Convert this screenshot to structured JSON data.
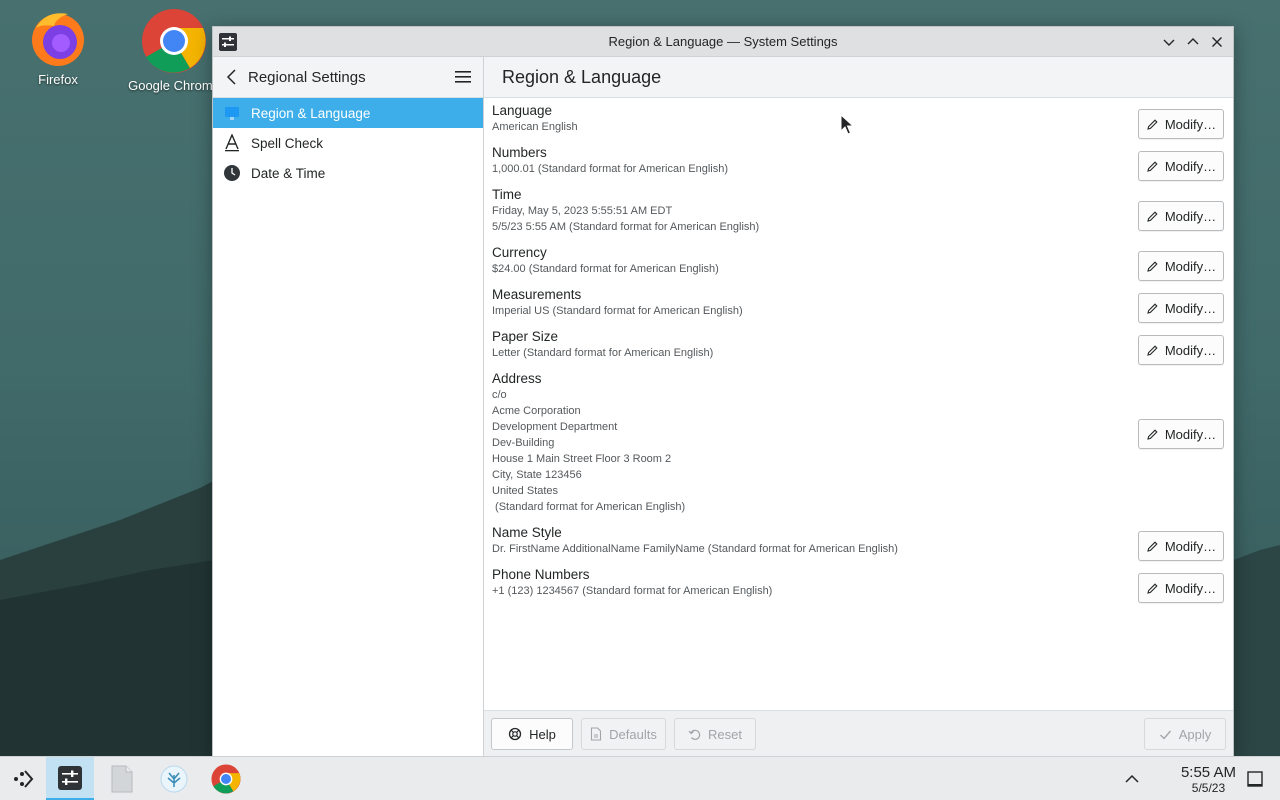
{
  "desktop": {
    "icons": [
      {
        "label": "Firefox",
        "icon": "firefox-icon"
      },
      {
        "label": "Google Chrome",
        "icon": "chrome-icon"
      }
    ]
  },
  "window": {
    "title": "Region & Language — System Settings",
    "controls": [
      "minimize",
      "maximize",
      "close"
    ]
  },
  "sidebar": {
    "title": "Regional Settings",
    "items": [
      {
        "label": "Region & Language",
        "icon": "region-language-icon",
        "active": true
      },
      {
        "label": "Spell Check",
        "icon": "spell-check-icon",
        "active": false
      },
      {
        "label": "Date & Time",
        "icon": "clock-icon",
        "active": false
      }
    ]
  },
  "main": {
    "title": "Region & Language",
    "modify_label": "Modify…",
    "settings": [
      {
        "title": "Language",
        "value": "American English"
      },
      {
        "title": "Numbers",
        "value": "1,000.01 (Standard format for American English)"
      },
      {
        "title": "Time",
        "value": "Friday, May 5, 2023 5:55:51 AM EDT\n5/5/23 5:55 AM (Standard format for American English)"
      },
      {
        "title": "Currency",
        "value": "$24.00 (Standard format for American English)"
      },
      {
        "title": "Measurements",
        "value": "Imperial US (Standard format for American English)"
      },
      {
        "title": "Paper Size",
        "value": "Letter (Standard format for American English)"
      },
      {
        "title": "Address",
        "value": "c/o\nAcme Corporation\nDevelopment Department\nDev-Building\nHouse 1 Main Street Floor 3 Room 2\nCity, State 123456\nUnited States\n (Standard format for American English)"
      },
      {
        "title": "Name Style",
        "value": "Dr. FirstName AdditionalName FamilyName (Standard format for American English)"
      },
      {
        "title": "Phone Numbers",
        "value": "+1 (123) 1234567 (Standard format for American English)"
      }
    ]
  },
  "footer": {
    "help": "Help",
    "defaults": "Defaults",
    "reset": "Reset",
    "apply": "Apply"
  },
  "taskbar": {
    "time": "5:55 AM",
    "date": "5/5/23"
  },
  "colors": {
    "accent": "#3daee9"
  }
}
